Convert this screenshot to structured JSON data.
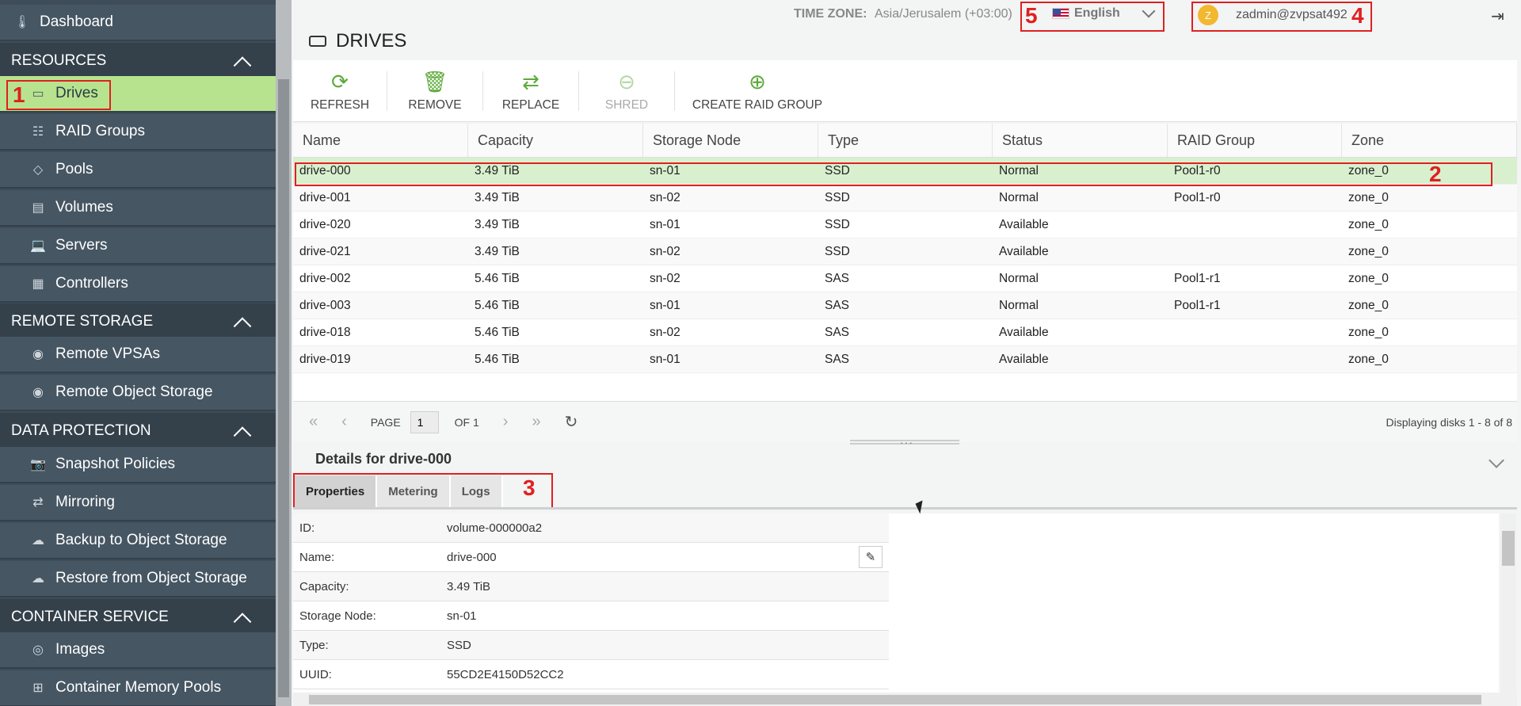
{
  "sidebar": {
    "dashboard": "Dashboard",
    "sections": [
      {
        "title": "RESOURCES"
      },
      {
        "title": "REMOTE STORAGE"
      },
      {
        "title": "DATA PROTECTION"
      },
      {
        "title": "CONTAINER SERVICE"
      }
    ],
    "items": {
      "drives": "Drives",
      "raid_groups": "RAID Groups",
      "pools": "Pools",
      "volumes": "Volumes",
      "servers": "Servers",
      "controllers": "Controllers",
      "remote_vpsas": "Remote VPSAs",
      "remote_object_storage": "Remote Object Storage",
      "snapshot_policies": "Snapshot Policies",
      "mirroring": "Mirroring",
      "backup": "Backup to Object Storage",
      "restore": "Restore from Object Storage",
      "images": "Images",
      "container_memory_pools": "Container Memory Pools"
    }
  },
  "header": {
    "timezone_label": "TIME ZONE:",
    "timezone_value": "Asia/Jerusalem (+03:00)",
    "language": "English",
    "avatar_letter": "Z",
    "user": "zadmin@zvpsat492"
  },
  "page": {
    "title": "DRIVES"
  },
  "toolbar": {
    "refresh": "REFRESH",
    "remove": "REMOVE",
    "replace": "REPLACE",
    "shred": "SHRED",
    "create_raid_group": "CREATE RAID GROUP"
  },
  "grid": {
    "columns": [
      "Name",
      "Capacity",
      "Storage Node",
      "Type",
      "Status",
      "RAID Group",
      "Zone"
    ],
    "rows": [
      [
        "drive-000",
        "3.49 TiB",
        "sn-01",
        "SSD",
        "Normal",
        "Pool1-r0",
        "zone_0"
      ],
      [
        "drive-001",
        "3.49 TiB",
        "sn-02",
        "SSD",
        "Normal",
        "Pool1-r0",
        "zone_0"
      ],
      [
        "drive-020",
        "3.49 TiB",
        "sn-01",
        "SSD",
        "Available",
        "",
        "zone_0"
      ],
      [
        "drive-021",
        "3.49 TiB",
        "sn-02",
        "SSD",
        "Available",
        "",
        "zone_0"
      ],
      [
        "drive-002",
        "5.46 TiB",
        "sn-02",
        "SAS",
        "Normal",
        "Pool1-r1",
        "zone_0"
      ],
      [
        "drive-003",
        "5.46 TiB",
        "sn-01",
        "SAS",
        "Normal",
        "Pool1-r1",
        "zone_0"
      ],
      [
        "drive-018",
        "5.46 TiB",
        "sn-02",
        "SAS",
        "Available",
        "",
        "zone_0"
      ],
      [
        "drive-019",
        "5.46 TiB",
        "sn-01",
        "SAS",
        "Available",
        "",
        "zone_0"
      ]
    ]
  },
  "pager": {
    "page_label": "PAGE",
    "page_value": "1",
    "of_label": "OF 1",
    "display": "Displaying disks 1 - 8 of 8"
  },
  "details": {
    "title": "Details for drive-000",
    "tabs": [
      "Properties",
      "Metering",
      "Logs"
    ],
    "properties": [
      {
        "label": "ID:",
        "value": "volume-000000a2"
      },
      {
        "label": "Name:",
        "value": "drive-000"
      },
      {
        "label": "Capacity:",
        "value": "3.49 TiB"
      },
      {
        "label": "Storage Node:",
        "value": "sn-01"
      },
      {
        "label": "Type:",
        "value": "SSD"
      },
      {
        "label": "UUID:",
        "value": "55CD2E4150D52CC2"
      }
    ]
  },
  "annotations": [
    "1",
    "2",
    "3",
    "4",
    "5"
  ],
  "colors": {
    "sidebar_bg": "#3e4d59",
    "active": "#b7e38f",
    "accent": "#5caa3a",
    "annotation": "#e02020"
  }
}
